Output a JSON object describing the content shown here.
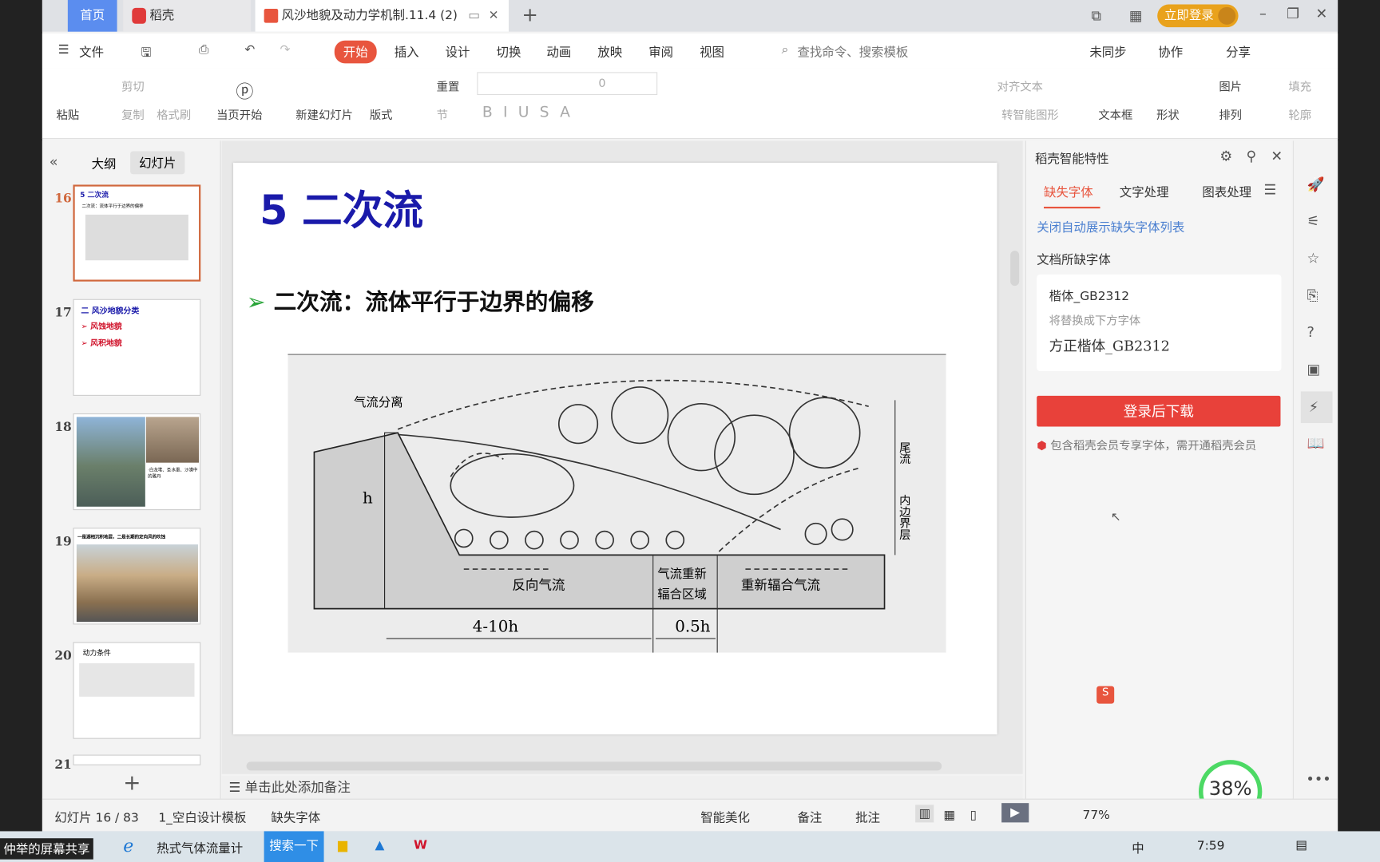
{
  "tabs": {
    "home": "首页",
    "daoke": "稻壳",
    "doc": "风沙地貌及动力学机制.11.4 (2)",
    "login": "立即登录"
  },
  "menu": {
    "file": "文件",
    "items": [
      "开始",
      "插入",
      "设计",
      "切换",
      "动画",
      "放映",
      "审阅",
      "视图"
    ],
    "search": "查找命令、搜索模板",
    "sync": "未同步",
    "collab": "协作",
    "share": "分享"
  },
  "ribbon": {
    "paste": "粘贴",
    "cut": "剪切",
    "copy": "复制",
    "format_painter": "格式刷",
    "from_current": "当页开始",
    "new_slide": "新建幻灯片",
    "layout": "版式",
    "reset": "重置",
    "section": "节",
    "font_size": "0",
    "align_text": "对齐文本",
    "smart_shape": "转智能图形",
    "textbox": "文本框",
    "shape": "形状",
    "picture": "图片",
    "arrange": "排列",
    "fill": "填充",
    "outline": "轮廓"
  },
  "left_panel": {
    "outline_tab": "大纲",
    "slides_tab": "幻灯片",
    "thumbs": [
      {
        "num": "16",
        "title": "5 二次流",
        "sub": "二次流：流体平行于边界的偏移"
      },
      {
        "num": "17",
        "title": "二 风沙地貌分类",
        "items": [
          "风蚀地貌",
          "风积地貌"
        ]
      },
      {
        "num": "18",
        "caption": "·白龙堆、圣水墨、沙漠中的雅丹"
      },
      {
        "num": "19",
        "title": "一是湖相沉积地层，二是长期的定向风的吹蚀"
      },
      {
        "num": "20",
        "title": "动力条件"
      },
      {
        "num": "21"
      }
    ]
  },
  "slide": {
    "title": "5  二次流",
    "bullet": "二次流：流体平行于边界的偏移",
    "figure": {
      "separation": "气流分离",
      "h": "h",
      "wake": "尾流",
      "inner_layer": "内边界层",
      "reverse_flow": "反向气流",
      "reattach_zone_1": "气流重新",
      "reattach_zone_2": "辐合区域",
      "reattached_flow": "重新辐合气流",
      "len1": "4-10h",
      "len2": "0.5h"
    }
  },
  "notes": "单击此处添加备注",
  "right_panel": {
    "title": "稻壳智能特性",
    "tabs": [
      "缺失字体",
      "文字处理",
      "图表处理"
    ],
    "close_auto": "关闭自动展示缺失字体列表",
    "missing_label": "文档所缺字体",
    "missing_font": "楷体_GB2312",
    "replace_hint": "将替换成下方字体",
    "replacement": "方正楷体_GB2312",
    "download": "登录后下载",
    "member_note": "包含稻壳会员专享字体，需开通稻壳会员",
    "progress": "38%"
  },
  "status": {
    "slide_pos": "幻灯片 16 / 83",
    "template": "1_空白设计模板",
    "missing_font": "缺失字体",
    "beautify": "智能美化",
    "notes": "备注",
    "comment": "批注",
    "zoom": "77%"
  },
  "taskbar": {
    "share_label": "仲举的屏幕共享",
    "ie_app": "热式气体流量计",
    "search": "搜索一下",
    "time": "7:59",
    "ime": "中"
  },
  "colors": {
    "accent": "#e8553e",
    "title_blue": "#1a1aaa",
    "download_red": "#e8413a",
    "link_blue": "#4a7fd0",
    "login_orange": "#e9a21c"
  }
}
